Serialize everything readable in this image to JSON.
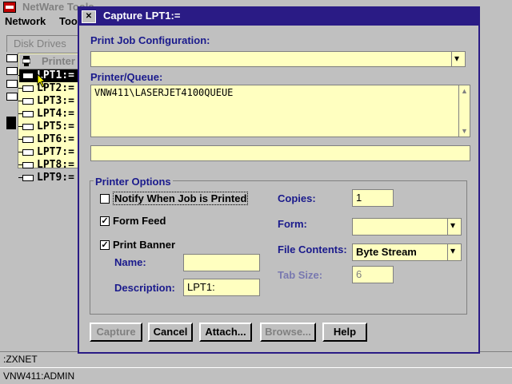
{
  "bg_window": {
    "title": "NetWare Tools",
    "menu": [
      {
        "label": "Network"
      },
      {
        "label": "Too"
      }
    ],
    "tab_label": "Disk Drives",
    "list_header": "Printer",
    "ports": [
      {
        "label": "LPT1:="
      },
      {
        "label": "LPT2:="
      },
      {
        "label": "LPT3:="
      },
      {
        "label": "LPT4:="
      },
      {
        "label": "LPT5:="
      },
      {
        "label": "LPT6:="
      },
      {
        "label": "LPT7:="
      },
      {
        "label": "LPT8:="
      },
      {
        "label": "LPT9:="
      }
    ],
    "selected_port_index": 0,
    "status_line1": ":ZXNET",
    "status_line2": "VNW411:ADMIN"
  },
  "dialog": {
    "title": "Capture LPT1:=",
    "print_job_config_label": "Print Job Configuration:",
    "print_job_config_value": "",
    "printer_queue_label": "Printer/Queue:",
    "printer_queue_value": "VNW411\\LASERJET4100QUEUE",
    "extra_field_value": "",
    "printer_options": {
      "group_label": "Printer Options",
      "notify_label": "Notify When Job is Printed",
      "notify_checked": false,
      "form_feed_label": "Form Feed",
      "form_feed_checked": true,
      "print_banner_label": "Print Banner",
      "print_banner_checked": true,
      "name_label": "Name:",
      "name_value": "",
      "description_label": "Description:",
      "description_value": "LPT1:",
      "copies_label": "Copies:",
      "copies_value": "1",
      "form_label": "Form:",
      "form_value": "",
      "file_contents_label": "File Contents:",
      "file_contents_value": "Byte Stream",
      "tab_size_label": "Tab Size:",
      "tab_size_value": "6",
      "tab_size_enabled": false
    },
    "buttons": {
      "capture": "Capture",
      "cancel": "Cancel",
      "attach": "Attach...",
      "browse": "Browse...",
      "help": "Help"
    },
    "colors": {
      "title_bar": "#2a1b85",
      "label_text": "#1a1a8c",
      "field_bg": "#ffffc0",
      "face": "#c0c0c0"
    }
  }
}
